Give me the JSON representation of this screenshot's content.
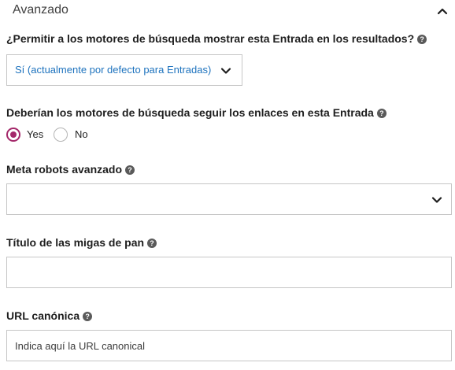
{
  "section": {
    "title": "Avanzado"
  },
  "search_visibility": {
    "label": "¿Permitir a los motores de búsqueda mostrar esta Entrada en los resultados?",
    "help": "?",
    "selected": "Sí (actualmente por defecto para Entradas)"
  },
  "follow_links": {
    "label": "Deberían los motores de búsqueda seguir los enlaces en esta Entrada",
    "help": "?",
    "options": [
      {
        "label": "Yes",
        "checked": true
      },
      {
        "label": "No",
        "checked": false
      }
    ]
  },
  "meta_robots": {
    "label": "Meta robots avanzado",
    "help": "?",
    "selected": ""
  },
  "breadcrumb_title": {
    "label": "Título de las migas de pan",
    "help": "?",
    "value": ""
  },
  "canonical_url": {
    "label": "URL canónica",
    "help": "?",
    "placeholder": "Indica aquí la URL canonical",
    "value": ""
  },
  "colors": {
    "accent": "#a4286a",
    "link": "#1e73be",
    "border": "#c6c6c6"
  },
  "icons": {
    "collapse": "chevron-up-icon",
    "dropdown": "chevron-down-icon",
    "help": "question-circle-icon"
  }
}
